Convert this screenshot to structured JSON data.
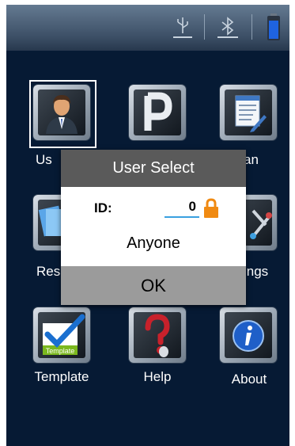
{
  "statusbar": {
    "icons": [
      "usb-icon",
      "bluetooth-icon",
      "battery-icon"
    ],
    "battery_color": "#1f63e0"
  },
  "tiles": [
    {
      "name": "user",
      "label": "Us",
      "icon": "user-icon"
    },
    {
      "name": "parking",
      "label": "",
      "icon": "p-icon"
    },
    {
      "name": "scan",
      "label": "an",
      "icon": "document-pen-icon"
    },
    {
      "name": "result",
      "label": "Res",
      "icon": "files-icon"
    },
    {
      "name": "settings",
      "label": "ings",
      "icon": "tools-icon"
    },
    {
      "name": "template",
      "label": "Template",
      "icon": "template-check-icon"
    },
    {
      "name": "help",
      "label": "Help",
      "icon": "help-icon"
    },
    {
      "name": "about",
      "label": "About",
      "icon": "info-icon"
    }
  ],
  "dialog": {
    "title": "User Select",
    "id_label": "ID:",
    "id_value": "0",
    "user_name": "Anyone",
    "ok_label": "OK"
  },
  "colors": {
    "lock": "#f08a12",
    "id_underline": "#3aa0e0",
    "info_blue": "#1f5fc8",
    "check_blue": "#1a6fd0"
  }
}
